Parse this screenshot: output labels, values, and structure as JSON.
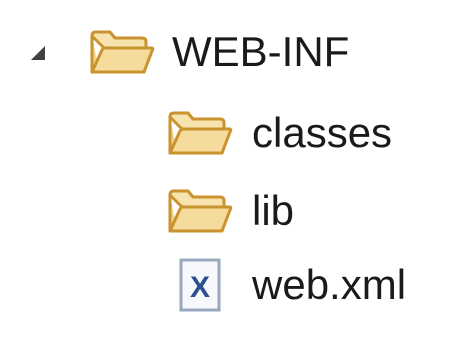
{
  "tree": {
    "root": {
      "label": "WEB-INF",
      "expanded": true,
      "icon": "folder-open-icon",
      "twisty_icon": "expanded-triangle-icon"
    },
    "children": [
      {
        "label": "classes",
        "icon": "folder-open-icon"
      },
      {
        "label": "lib",
        "icon": "folder-open-icon"
      },
      {
        "label": "web.xml",
        "icon": "xml-file-icon"
      }
    ]
  },
  "colors": {
    "folder_fill": "#f3d58e",
    "folder_stroke": "#c9932f",
    "xml_glyph": "#2b4f8f",
    "text": "#1a1a1a",
    "twisty": "#404040"
  }
}
